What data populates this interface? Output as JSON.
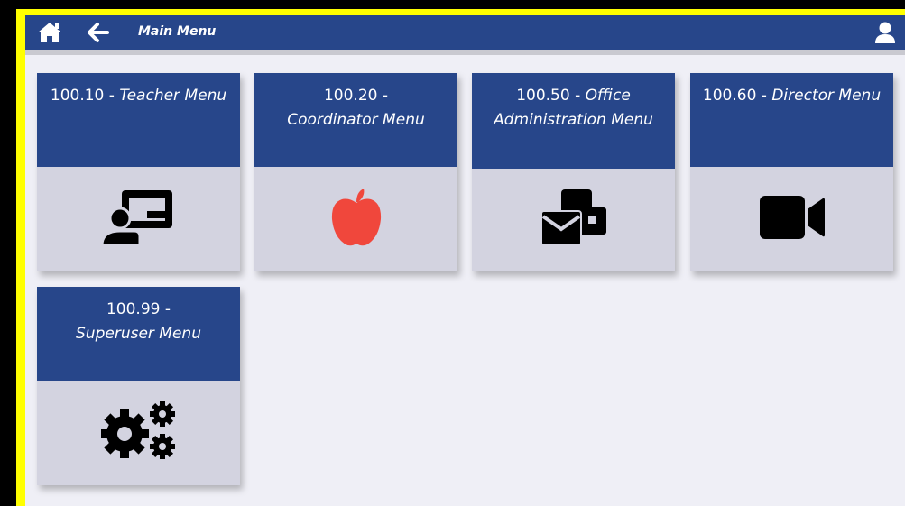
{
  "header": {
    "title": "Main Menu",
    "icons": [
      "home-icon",
      "back-arrow-icon",
      "user-icon"
    ]
  },
  "tiles": [
    {
      "code": "100.10 -",
      "name": "Teacher Menu",
      "icon": "teacher-presentation-icon"
    },
    {
      "code": "100.20 -",
      "name": "Coordinator Menu",
      "icon": "apple-icon"
    },
    {
      "code": "100.50 -",
      "name": "Office Administration Menu",
      "icon": "mail-envelope-icon"
    },
    {
      "code": "100.60 -",
      "name": "Director Menu",
      "icon": "video-camera-icon"
    },
    {
      "code": "100.99 -",
      "name": "Superuser Menu",
      "icon": "gears-icon"
    }
  ],
  "colors": {
    "frame": "#ffff00",
    "header_bg": "#27468a",
    "tile_body": "#d3d3e0",
    "page_bg": "#efeff6",
    "apple_icon": "#f0473c"
  }
}
